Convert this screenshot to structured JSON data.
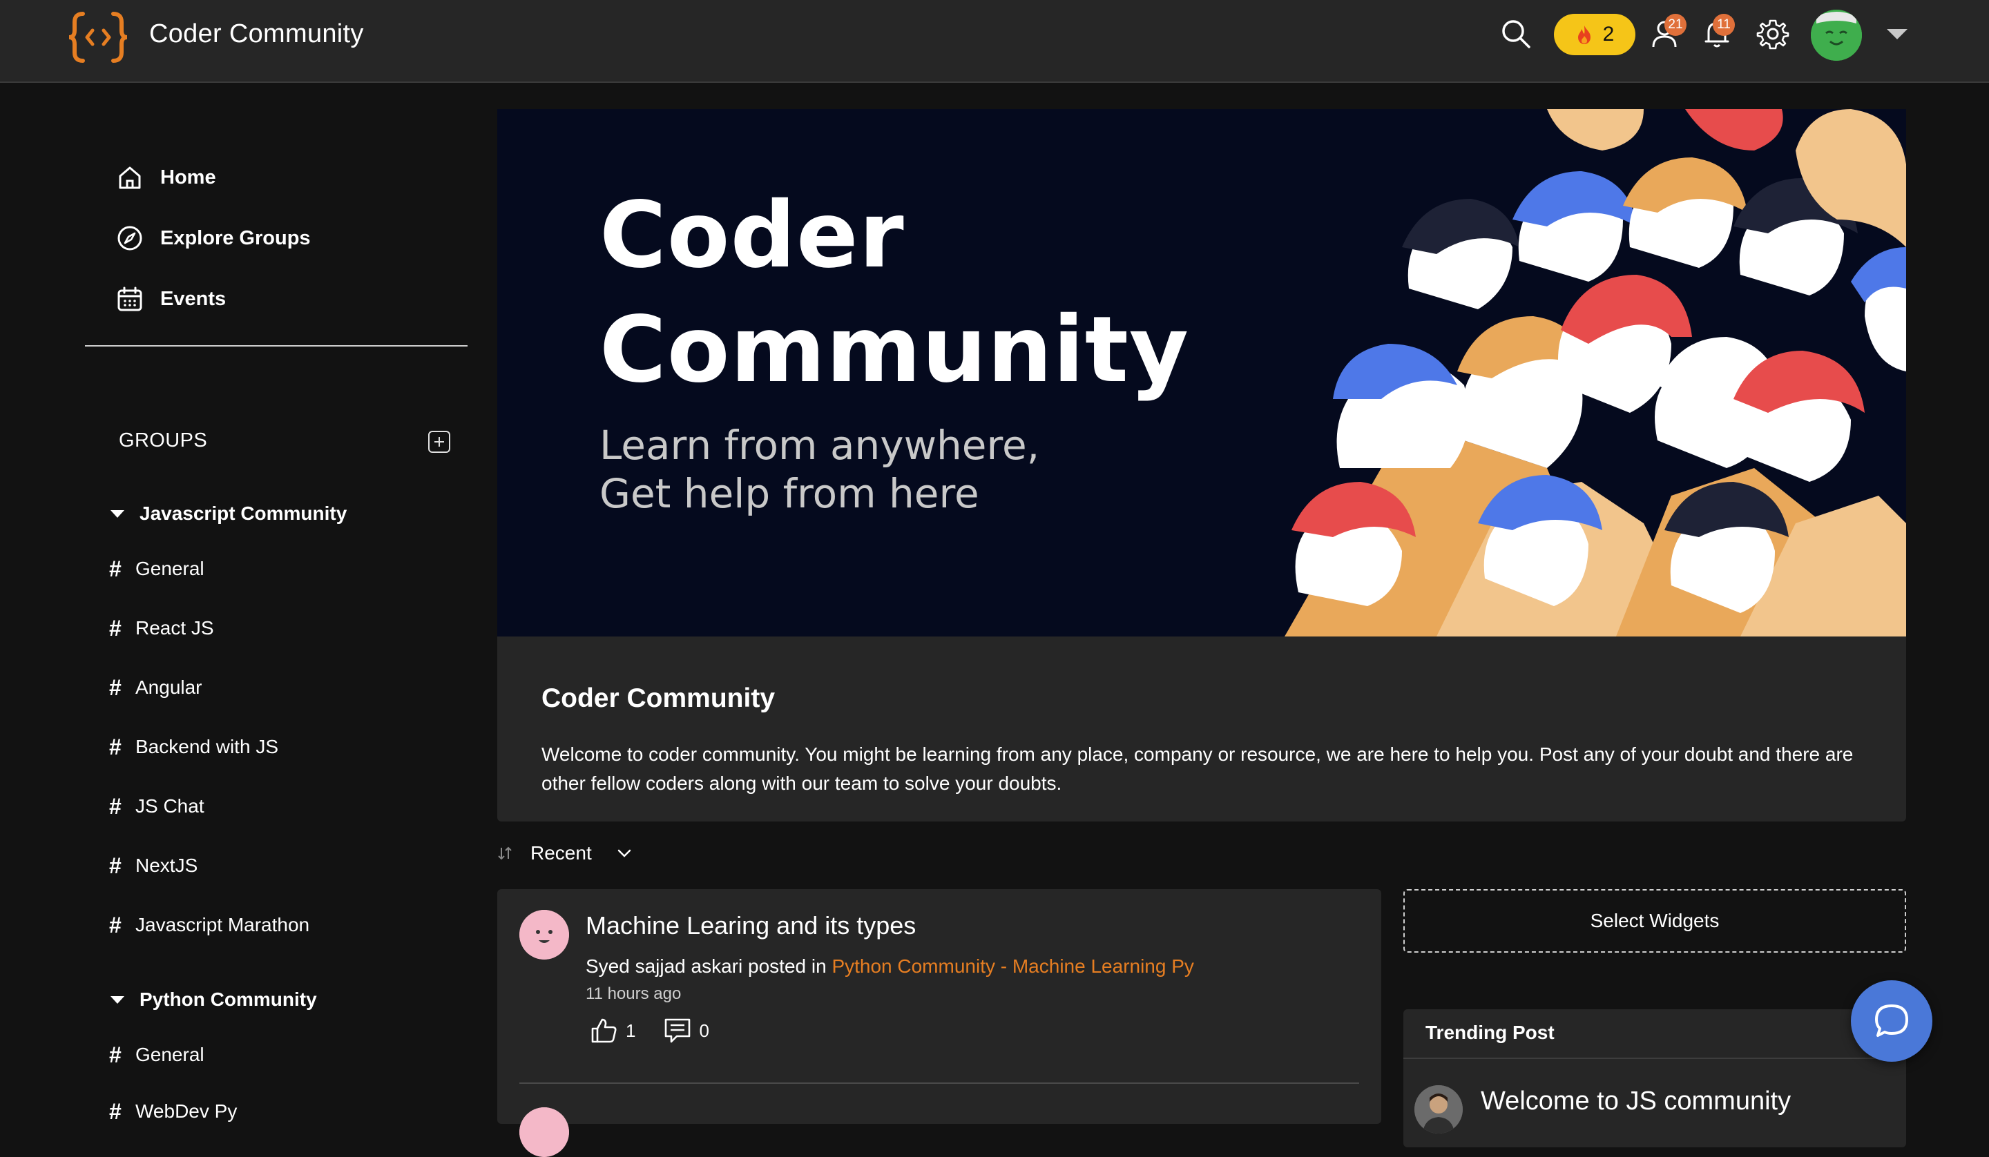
{
  "app": {
    "title": "Coder Community",
    "brand_color": "#e67e22"
  },
  "topbar": {
    "icons": [
      "search-icon",
      "fire-icon",
      "user-icon",
      "bell-icon",
      "gear-icon",
      "avatar",
      "chevron-down-icon"
    ],
    "streak_count": "2",
    "friend_requests_badge": "21",
    "notifications_badge": "11"
  },
  "sidebar": {
    "nav": [
      {
        "label": "Home",
        "icon": "home-icon"
      },
      {
        "label": "Explore Groups",
        "icon": "compass-icon"
      },
      {
        "label": "Events",
        "icon": "calendar-icon"
      }
    ],
    "groups_title": "GROUPS",
    "groups": [
      {
        "name": "Javascript Community",
        "channels": [
          "General",
          "React JS",
          "Angular",
          "Backend with JS",
          "JS Chat",
          "NextJS",
          "Javascript Marathon"
        ]
      },
      {
        "name": "Python Community",
        "channels": [
          "General",
          "WebDev Py"
        ]
      }
    ]
  },
  "banner": {
    "title_line1": "Coder",
    "title_line2": "Community",
    "subtitle_line1": "Learn from anywhere,",
    "subtitle_line2": "Get help from here"
  },
  "info": {
    "title": "Coder Community",
    "description": "Welcome to coder community. You might be learning from any place, company or resource, we are here to help you. Post any of your doubt and there are other fellow coders along with our team to solve your doubts."
  },
  "feed": {
    "sort_label": "Recent",
    "posts": [
      {
        "title": "Machine Learing and its types",
        "author": "Syed sajjad askari",
        "posted_in_text": "posted in",
        "group": "Python Community - Machine Learning Py",
        "time": "11 hours ago",
        "likes": "1",
        "comments": "0"
      }
    ]
  },
  "widgets": {
    "select_label": "Select Widgets",
    "trending_title": "Trending Post",
    "trending_posts": [
      "Welcome to JS community"
    ]
  }
}
